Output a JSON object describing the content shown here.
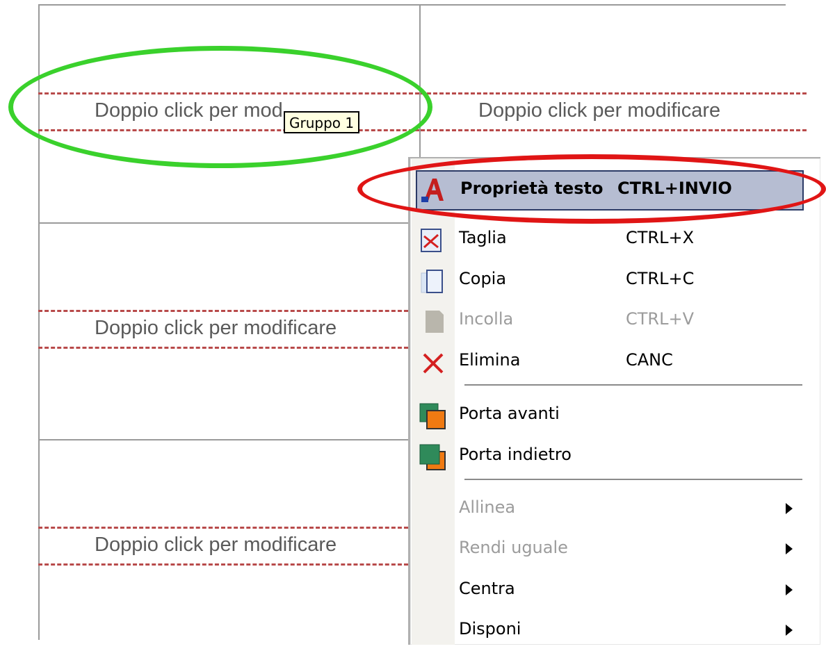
{
  "document": {
    "frames": [
      {
        "text": "Doppio click per modificare"
      },
      {
        "text": "Doppio click per modificare"
      },
      {
        "text": "Doppio click per modificare"
      },
      {
        "text": "Doppio click per modificare"
      }
    ],
    "tooltip": "Gruppo 1"
  },
  "annotations": {
    "green_ellipse_color": "#3ad12c",
    "red_ellipse_color": "#e01515"
  },
  "context_menu": {
    "items": [
      {
        "label": "Proprietà testo",
        "shortcut": "CTRL+INVIO",
        "icon": "text-properties-icon",
        "state": "highlighted"
      },
      {
        "label": "Taglia",
        "shortcut": "CTRL+X",
        "icon": "cut-icon",
        "state": "enabled"
      },
      {
        "label": "Copia",
        "shortcut": "CTRL+C",
        "icon": "copy-icon",
        "state": "enabled"
      },
      {
        "label": "Incolla",
        "shortcut": "CTRL+V",
        "icon": "paste-icon",
        "state": "disabled"
      },
      {
        "label": "Elimina",
        "shortcut": "CANC",
        "icon": "delete-icon",
        "state": "enabled"
      },
      {
        "label": "Porta avanti",
        "icon": "bring-forward-icon",
        "state": "enabled"
      },
      {
        "label": "Porta indietro",
        "icon": "send-backward-icon",
        "state": "enabled"
      },
      {
        "label": "Allinea",
        "submenu": true,
        "state": "disabled"
      },
      {
        "label": "Rendi uguale",
        "submenu": true,
        "state": "disabled"
      },
      {
        "label": "Centra",
        "submenu": true,
        "state": "enabled"
      },
      {
        "label": "Disponi",
        "submenu": true,
        "state": "enabled"
      }
    ]
  }
}
